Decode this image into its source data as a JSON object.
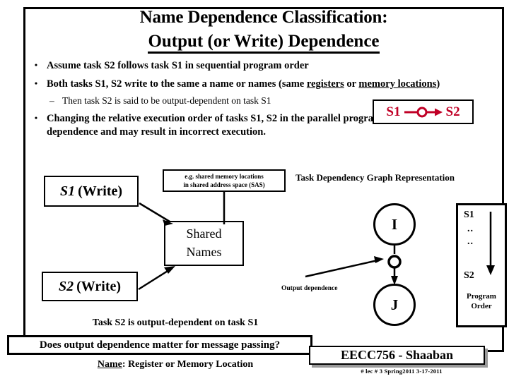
{
  "slide": {
    "title_line1": "Name Dependence Classification:",
    "title_line2": "Output (or Write) Dependence",
    "bullets": [
      {
        "marker": "•",
        "text_parts": [
          {
            "t": "Assume  task S2 follows task S1 in sequential program order",
            "u": false
          }
        ]
      },
      {
        "marker": "•",
        "text_parts": [
          {
            "t": "Both tasks S1, S2  write to the same  a name or names (same ",
            "u": false
          },
          {
            "t": "registers",
            "u": true
          },
          {
            "t": " or ",
            "u": false
          },
          {
            "t": "memory locations",
            "u": true
          },
          {
            "t": ")",
            "u": false
          }
        ]
      }
    ],
    "sub_bullet": {
      "marker": "–",
      "text": "Then task S2 is said to be output-dependent on task S1"
    },
    "bullet3": {
      "marker": "•",
      "text": "Changing the relative execution order of tasks S1, S2  in the parallel program violates this name dependence and may result in  incorrect execution."
    },
    "notation_box": {
      "left_label": "S1",
      "right_label": "S2",
      "color": "#C00026",
      "glyph": "arrow-with-circle"
    },
    "diagram": {
      "box_s1_italic": "S1",
      "box_s1_rest": "(Write)",
      "box_s2_italic": "S2",
      "box_s2_rest": "(Write)",
      "shared_line1": "Shared",
      "shared_line2": "Names",
      "note_line1": "e.g. shared memory locations",
      "note_line2": "in shared address space (SAS)"
    },
    "graph": {
      "caption": "Task Dependency Graph Representation",
      "node_i": "I",
      "node_j": "J",
      "edge_label": "Output dependence"
    },
    "program_order": {
      "first": "S1",
      "dot1": "..",
      "dot2": "..",
      "last": "S2",
      "label_line1": "Program",
      "label_line2": "Order"
    },
    "bottom": {
      "task_statement": "Task S2 is output-dependent on task S1",
      "question": "Does output dependence matter for message passing?",
      "name_underlined": "Name",
      "name_rest": ": Register  or  Memory Location"
    },
    "footer": {
      "course": "EECC756 - Shaaban",
      "meta": "#  lec # 3   Spring2011   3-17-2011"
    }
  }
}
